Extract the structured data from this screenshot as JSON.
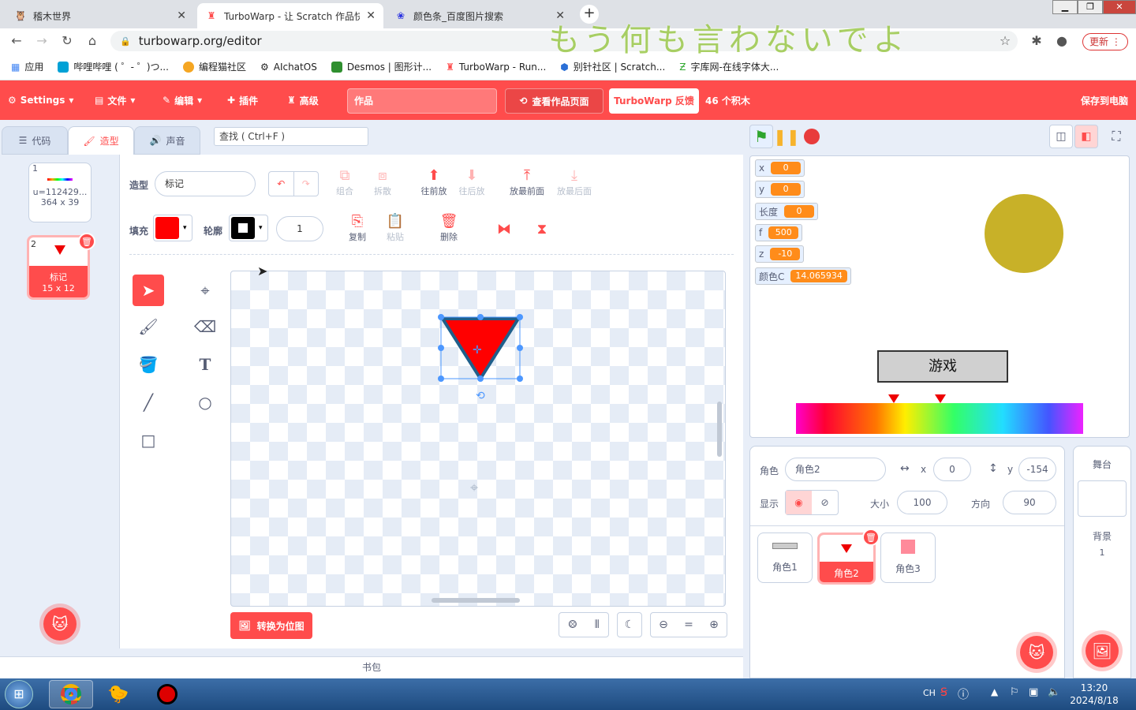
{
  "browser": {
    "tabs": [
      {
        "title": "稽木世界"
      },
      {
        "title": "TurboWarp - 让 Scratch 作品快"
      },
      {
        "title": "颜色条_百度图片搜索"
      }
    ],
    "url": "turbowarp.org/editor",
    "overlay_text": "もう何も言わないでよ",
    "update_label": "更新",
    "bookmarks": [
      "应用",
      "哔哩哔哩 ( ゜- ゜)つ...",
      "编程猫社区",
      "AIchatOS",
      "Desmos | 图形计...",
      "TurboWarp - Run...",
      "别针社区 | Scratch...",
      "字库网-在线字体大..."
    ]
  },
  "menu": {
    "settings": "Settings",
    "file": "文件",
    "edit": "编辑",
    "addons": "插件",
    "advanced": "高级",
    "project_title": "作品",
    "see_project": "查看作品页面",
    "feedback": "TurboWarp 反馈",
    "block_count": "46 个积木",
    "save": "保存到电脑"
  },
  "editor_tabs": {
    "code": "代码",
    "costumes": "造型",
    "sounds": "声音"
  },
  "search_placeholder": "查找 ( Ctrl+F )",
  "costumes": [
    {
      "index": "1",
      "name": "u=112429...",
      "size": "364 x 39"
    },
    {
      "index": "2",
      "name": "标记",
      "size": "15 x 12"
    }
  ],
  "paint": {
    "costume_label": "造型",
    "costume_name": "标记",
    "group": "组合",
    "ungroup": "拆散",
    "forward": "往前放",
    "backward": "往后放",
    "front": "放最前面",
    "back": "放最后面",
    "fill_label": "填充",
    "outline_label": "轮廓",
    "outline_width": "1",
    "copy": "复制",
    "paste": "粘贴",
    "delete": "删除",
    "convert_bitmap": "转换为位图",
    "fill_color": "#ff0000",
    "outline_color": "#000000"
  },
  "backpack": "书包",
  "monitors": [
    {
      "label": "x",
      "value": "0"
    },
    {
      "label": "y",
      "value": "0"
    },
    {
      "label": "长度",
      "value": "0"
    },
    {
      "label": "f",
      "value": "500"
    },
    {
      "label": "z",
      "value": "-10"
    },
    {
      "label": "颜色C",
      "value": "14.065934"
    }
  ],
  "stage_button": "游戏",
  "sprite_info": {
    "sprite_label": "角色",
    "sprite_name": "角色2",
    "x_label": "x",
    "x": "0",
    "y_label": "y",
    "y": "-154",
    "show_label": "显示",
    "size_label": "大小",
    "size": "100",
    "direction_label": "方向",
    "direction": "90"
  },
  "sprites": [
    "角色1",
    "角色2",
    "角色3"
  ],
  "stage_pane": {
    "title": "舞台",
    "backdrops_label": "背景",
    "backdrops_count": "1"
  },
  "taskbar": {
    "lang": "CH",
    "time": "13:20",
    "date": "2024/8/18"
  },
  "colors": {
    "accent": "#ff4c4c",
    "circle": "#c8b128"
  }
}
